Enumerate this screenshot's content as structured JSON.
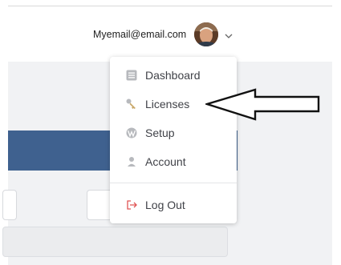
{
  "header": {
    "email": "Myemail@email.com"
  },
  "icons": {
    "avatar": "user-avatar",
    "account_menu_toggle": "chevron-down-icon",
    "dashboard": "dashboard-icon",
    "licenses": "key-icon",
    "setup": "wordpress-icon",
    "account": "user-icon",
    "logout": "logout-icon",
    "annotation": "arrow-left-icon"
  },
  "menu": {
    "items": [
      {
        "label": "Dashboard"
      },
      {
        "label": "Licenses"
      },
      {
        "label": "Setup"
      },
      {
        "label": "Account"
      }
    ],
    "logout": {
      "label": "Log Out"
    }
  },
  "colors": {
    "brand_band": "#3f618f",
    "logout_accent": "#e05555",
    "menu_icon": "#b7b9bd"
  }
}
